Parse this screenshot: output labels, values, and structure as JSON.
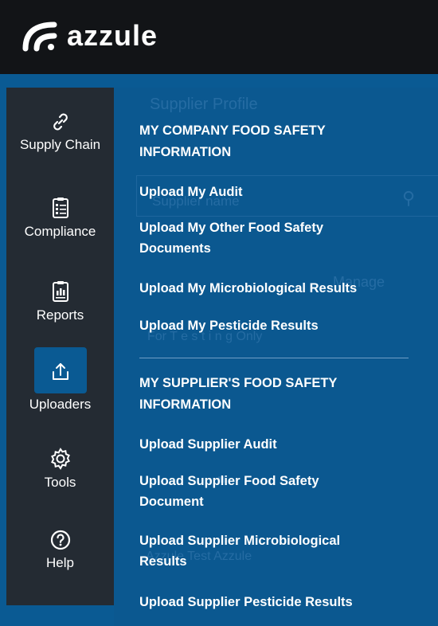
{
  "brand": {
    "name": "azzule"
  },
  "sidebar": {
    "items": [
      {
        "label": "Supply Chain",
        "icon": "link-icon"
      },
      {
        "label": "Compliance",
        "icon": "clipboard-icon"
      },
      {
        "label": "Reports",
        "icon": "report-icon"
      },
      {
        "label": "Uploaders",
        "icon": "upload-icon",
        "active": true
      },
      {
        "label": "Tools",
        "icon": "gear-icon"
      },
      {
        "label": "Help",
        "icon": "help-icon"
      }
    ]
  },
  "background": {
    "supplier_profile": "Supplier Profile",
    "supplier_name_placeholder": "Supplier name",
    "manage": "Manage",
    "for_testing": "For T e s t i n g Only",
    "azzule": "Azzule Test Azzule"
  },
  "menu": {
    "company_heading": "MY COMPANY FOOD SAFETY INFORMATION",
    "company_links": [
      "Upload My Audit",
      "Upload My Other Food Safety Documents",
      "Upload My Microbiological Results",
      "Upload My Pesticide Results"
    ],
    "supplier_heading": "MY SUPPLIER'S FOOD SAFETY INFORMATION",
    "supplier_links": [
      "Upload Supplier Audit",
      "Upload Supplier Food Safety Document",
      "Upload Supplier Microbiological Results",
      "Upload Supplier Pesticide Results"
    ]
  },
  "colors": {
    "topbar": "#121417",
    "sidebar": "#242b33",
    "accent": "#0a5a93"
  }
}
